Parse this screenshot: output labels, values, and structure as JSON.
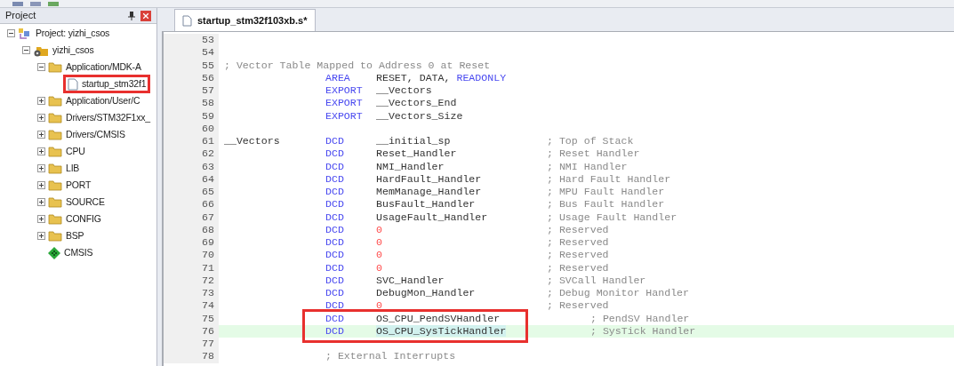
{
  "project_panel": {
    "title": "Project",
    "tree": [
      {
        "label": "Project: yizhi_csos",
        "kind": "project",
        "expanded": true,
        "marked": false,
        "children": [
          {
            "label": "yizhi_csos",
            "kind": "target",
            "expanded": true,
            "marked": false,
            "children": [
              {
                "label": "Application/MDK-A",
                "kind": "folder",
                "expanded": true,
                "marked": false,
                "children": [
                  {
                    "label": "startup_stm32f1",
                    "kind": "file",
                    "marked": true
                  }
                ]
              },
              {
                "label": "Application/User/C",
                "kind": "folder",
                "expanded": false,
                "marked": false
              },
              {
                "label": "Drivers/STM32F1xx_",
                "kind": "folder",
                "expanded": false,
                "marked": false
              },
              {
                "label": "Drivers/CMSIS",
                "kind": "folder",
                "expanded": false,
                "marked": false
              },
              {
                "label": "CPU",
                "kind": "folder",
                "expanded": false,
                "marked": false
              },
              {
                "label": "LIB",
                "kind": "folder",
                "expanded": false,
                "marked": false
              },
              {
                "label": "PORT",
                "kind": "folder",
                "expanded": false,
                "marked": false
              },
              {
                "label": "SOURCE",
                "kind": "folder",
                "expanded": false,
                "marked": false
              },
              {
                "label": "CONFIG",
                "kind": "folder",
                "expanded": false,
                "marked": false
              },
              {
                "label": "BSP",
                "kind": "folder",
                "expanded": false,
                "marked": false
              },
              {
                "label": "CMSIS",
                "kind": "component",
                "marked": false
              }
            ]
          }
        ]
      }
    ]
  },
  "tabs": [
    {
      "label": "startup_stm32f103xb.s*",
      "selected": true
    }
  ],
  "editor": {
    "lines": [
      {
        "n": "53",
        "kind": "blank",
        "current": false,
        "marked": false
      },
      {
        "n": "54",
        "kind": "blank",
        "current": false,
        "marked": false
      },
      {
        "n": "55",
        "kind": "comment",
        "text": "; Vector Table Mapped to Address 0 at Reset",
        "current": false,
        "marked": false
      },
      {
        "n": "56",
        "kind": "code",
        "op": "AREA",
        "args": [
          {
            "text": "RESET, DATA, ",
            "kind": "plain"
          },
          {
            "text": "READONLY",
            "kind": "keyword"
          }
        ],
        "current": false,
        "marked": false
      },
      {
        "n": "57",
        "kind": "code",
        "op": "EXPORT",
        "args": [
          {
            "text": "__Vectors",
            "kind": "plain"
          }
        ],
        "current": false,
        "marked": false
      },
      {
        "n": "58",
        "kind": "code",
        "op": "EXPORT",
        "args": [
          {
            "text": "__Vectors_End",
            "kind": "plain"
          }
        ],
        "current": false,
        "marked": false
      },
      {
        "n": "59",
        "kind": "code",
        "op": "EXPORT",
        "args": [
          {
            "text": "__Vectors_Size",
            "kind": "plain"
          }
        ],
        "current": false,
        "marked": false
      },
      {
        "n": "60",
        "kind": "blank",
        "current": false,
        "marked": false
      },
      {
        "n": "61",
        "kind": "code",
        "label": "__Vectors",
        "op": "DCD",
        "args": [
          {
            "text": "__initial_sp",
            "kind": "plain"
          }
        ],
        "comment": "; Top of Stack",
        "current": false,
        "marked": false
      },
      {
        "n": "62",
        "kind": "code",
        "op": "DCD",
        "args": [
          {
            "text": "Reset_Handler",
            "kind": "plain"
          }
        ],
        "comment": "; Reset Handler",
        "current": false,
        "marked": false
      },
      {
        "n": "63",
        "kind": "code",
        "op": "DCD",
        "args": [
          {
            "text": "NMI_Handler",
            "kind": "plain"
          }
        ],
        "comment": "; NMI Handler",
        "current": false,
        "marked": false
      },
      {
        "n": "64",
        "kind": "code",
        "op": "DCD",
        "args": [
          {
            "text": "HardFault_Handler",
            "kind": "plain"
          }
        ],
        "comment": "; Hard Fault Handler",
        "current": false,
        "marked": false
      },
      {
        "n": "65",
        "kind": "code",
        "op": "DCD",
        "args": [
          {
            "text": "MemManage_Handler",
            "kind": "plain"
          }
        ],
        "comment": "; MPU Fault Handler",
        "current": false,
        "marked": false
      },
      {
        "n": "66",
        "kind": "code",
        "op": "DCD",
        "args": [
          {
            "text": "BusFault_Handler",
            "kind": "plain"
          }
        ],
        "comment": "; Bus Fault Handler",
        "current": false,
        "marked": false
      },
      {
        "n": "67",
        "kind": "code",
        "op": "DCD",
        "args": [
          {
            "text": "UsageFault_Handler",
            "kind": "plain"
          }
        ],
        "comment": "; Usage Fault Handler",
        "current": false,
        "marked": false
      },
      {
        "n": "68",
        "kind": "code",
        "op": "DCD",
        "args": [
          {
            "text": "0",
            "kind": "number"
          }
        ],
        "comment": "; Reserved",
        "current": false,
        "marked": false
      },
      {
        "n": "69",
        "kind": "code",
        "op": "DCD",
        "args": [
          {
            "text": "0",
            "kind": "number"
          }
        ],
        "comment": "; Reserved",
        "current": false,
        "marked": false
      },
      {
        "n": "70",
        "kind": "code",
        "op": "DCD",
        "args": [
          {
            "text": "0",
            "kind": "number"
          }
        ],
        "comment": "; Reserved",
        "current": false,
        "marked": false
      },
      {
        "n": "71",
        "kind": "code",
        "op": "DCD",
        "args": [
          {
            "text": "0",
            "kind": "number"
          }
        ],
        "comment": "; Reserved",
        "current": false,
        "marked": false
      },
      {
        "n": "72",
        "kind": "code",
        "op": "DCD",
        "args": [
          {
            "text": "SVC_Handler",
            "kind": "plain"
          }
        ],
        "comment": "; SVCall Handler",
        "current": false,
        "marked": false
      },
      {
        "n": "73",
        "kind": "code",
        "op": "DCD",
        "args": [
          {
            "text": "DebugMon_Handler",
            "kind": "plain"
          }
        ],
        "comment": "; Debug Monitor Handler",
        "current": false,
        "marked": false
      },
      {
        "n": "74",
        "kind": "code",
        "op": "DCD",
        "args": [
          {
            "text": "0",
            "kind": "number"
          }
        ],
        "comment": "; Reserved",
        "current": false,
        "marked": false
      },
      {
        "n": "75",
        "kind": "code",
        "op": "DCD",
        "args": [
          {
            "text": "OS_CPU_PendSVHandler",
            "kind": "plain"
          }
        ],
        "comment": "; PendSV Handler",
        "current": false,
        "marked": true
      },
      {
        "n": "76",
        "kind": "code",
        "op": "DCD",
        "args": [
          {
            "text": "OS_CPU_SysTickHandler",
            "kind": "plain"
          }
        ],
        "comment": "; SysTick Handler",
        "current": true,
        "marked": true
      },
      {
        "n": "77",
        "kind": "blank",
        "current": false,
        "marked": false
      },
      {
        "n": "78",
        "kind": "indented_comment",
        "text": "; External Interrupts",
        "current": false,
        "marked": false
      }
    ]
  }
}
